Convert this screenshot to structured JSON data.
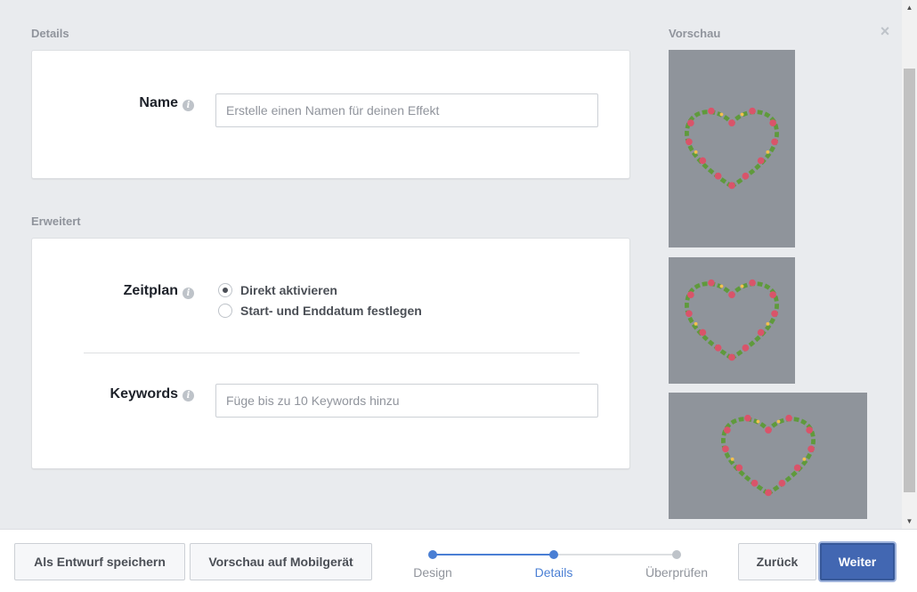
{
  "details": {
    "section_label": "Details",
    "name_label": "Name",
    "name_placeholder": "Erstelle einen Namen für deinen Effekt"
  },
  "advanced": {
    "section_label": "Erweitert",
    "schedule_label": "Zeitplan",
    "schedule_options": [
      {
        "label": "Direkt aktivieren",
        "checked": true
      },
      {
        "label": "Start- und Enddatum festlegen",
        "checked": false
      }
    ],
    "keywords_label": "Keywords",
    "keywords_placeholder": "Füge bis zu 10 Keywords hinzu"
  },
  "preview": {
    "label": "Vorschau",
    "items": [
      "portrait",
      "square",
      "landscape"
    ]
  },
  "info_icon": "info-icon",
  "info_glyph": "i",
  "close_glyph": "×",
  "footer": {
    "save_draft": "Als Entwurf speichern",
    "preview_mobile": "Vorschau auf Mobilgerät",
    "back": "Zurück",
    "next": "Weiter",
    "steps": [
      {
        "label": "Design",
        "state": "done"
      },
      {
        "label": "Details",
        "state": "current"
      },
      {
        "label": "Überprüfen",
        "state": "upcoming"
      }
    ]
  },
  "colors": {
    "accent": "#4267b2",
    "step_active": "#4a7fd4",
    "step_inactive": "#bec3c9",
    "preview_bg": "#8f949b"
  }
}
